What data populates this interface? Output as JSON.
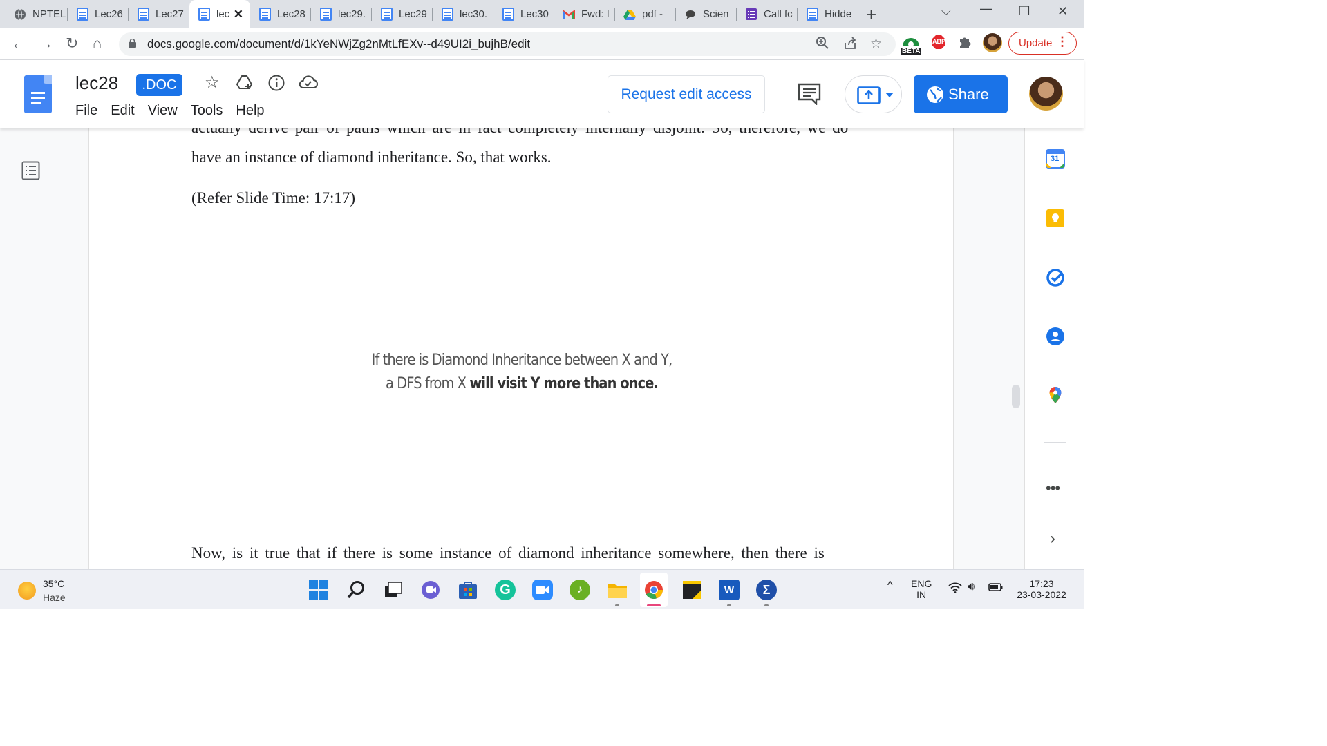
{
  "browser": {
    "tabs": [
      {
        "label": "NPTEL",
        "icon": "globe-icon",
        "active": false
      },
      {
        "label": "Lec26",
        "icon": "docs-icon",
        "active": false
      },
      {
        "label": "Lec27",
        "icon": "docs-icon",
        "active": false
      },
      {
        "label": "lec",
        "icon": "docs-icon",
        "active": true
      },
      {
        "label": "Lec28",
        "icon": "docs-icon",
        "active": false
      },
      {
        "label": "lec29.",
        "icon": "docs-icon",
        "active": false
      },
      {
        "label": "Lec29",
        "icon": "docs-icon",
        "active": false
      },
      {
        "label": "lec30.",
        "icon": "docs-icon",
        "active": false
      },
      {
        "label": "Lec30",
        "icon": "docs-icon",
        "active": false
      },
      {
        "label": "Fwd: I",
        "icon": "gmail-icon",
        "active": false
      },
      {
        "label": "pdf -",
        "icon": "drive-icon",
        "active": false
      },
      {
        "label": "Scien",
        "icon": "chat-icon",
        "active": false
      },
      {
        "label": "Call fc",
        "icon": "forms-icon",
        "active": false
      },
      {
        "label": "Hidde",
        "icon": "docs-icon",
        "active": false
      }
    ],
    "url": "docs.google.com/document/d/1kYeNWjZg2nMtLfEXv--d49UI2i_bujhB/edit",
    "update_label": "Update",
    "ext_beta_label": "BETA",
    "ext_abp_label": "ABP"
  },
  "docs": {
    "title": "lec28",
    "badge": ".DOC",
    "menu": [
      "File",
      "Edit",
      "View",
      "Tools",
      "Help"
    ],
    "request_edit_label": "Request edit access",
    "share_label": "Share"
  },
  "document": {
    "cut_line": "actually derive pair of paths which are in fact completely internally disjoint. So, therefore, we do",
    "line1": "have an instance of diamond inheritance. So, that works.",
    "line2": "(Refer Slide Time: 17:17)",
    "slide_line1": "If there is Diamond Inheritance between X and Y,",
    "slide_line2_plain": "a DFS from X ",
    "slide_line2_bold": "will visit Y more than once.",
    "line3": "Now, is it true that if there is some instance of diamond inheritance somewhere, then there is"
  },
  "sidepanel": {
    "calendar_day": "31"
  },
  "taskbar": {
    "temperature": "35°C",
    "weather": "Haze",
    "lang_line1": "ENG",
    "lang_line2": "IN",
    "time": "17:23",
    "date": "23-03-2022"
  },
  "colors": {
    "accent": "#1a73e8",
    "update_red": "#d93025",
    "tabstrip_bg": "#dee1e6"
  }
}
